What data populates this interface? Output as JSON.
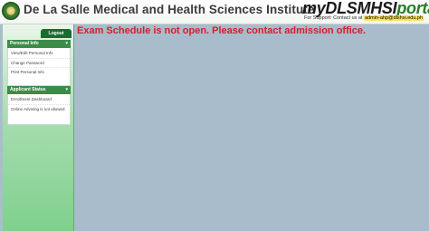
{
  "header": {
    "title": "De La Salle Medical and Health Sciences Institute",
    "brand_main": "myDLSMHSI",
    "brand_suffix": "portal",
    "support_label": "For Support: Contact us at",
    "support_email": "admin-ahp@dlshsi.edu.ph",
    "logo_icon": "institution-seal-icon"
  },
  "sidebar": {
    "logout_label": "Logout",
    "sections": [
      {
        "header": "Personal Info",
        "items": [
          "View/Edit Personal Info",
          "Change Password",
          "Print Personal Info"
        ]
      },
      {
        "header": "Applicant Status",
        "items": [
          "Enrollment Dashboard",
          "Online Advising is not allowed"
        ]
      }
    ]
  },
  "main": {
    "message": "Exam Schedule is not open. Please contact admission office."
  },
  "colors": {
    "accent_green": "#1f6a2e",
    "section_green": "#3d8b48",
    "alert_red": "#d1202f",
    "content_bg": "#a8bccb"
  }
}
